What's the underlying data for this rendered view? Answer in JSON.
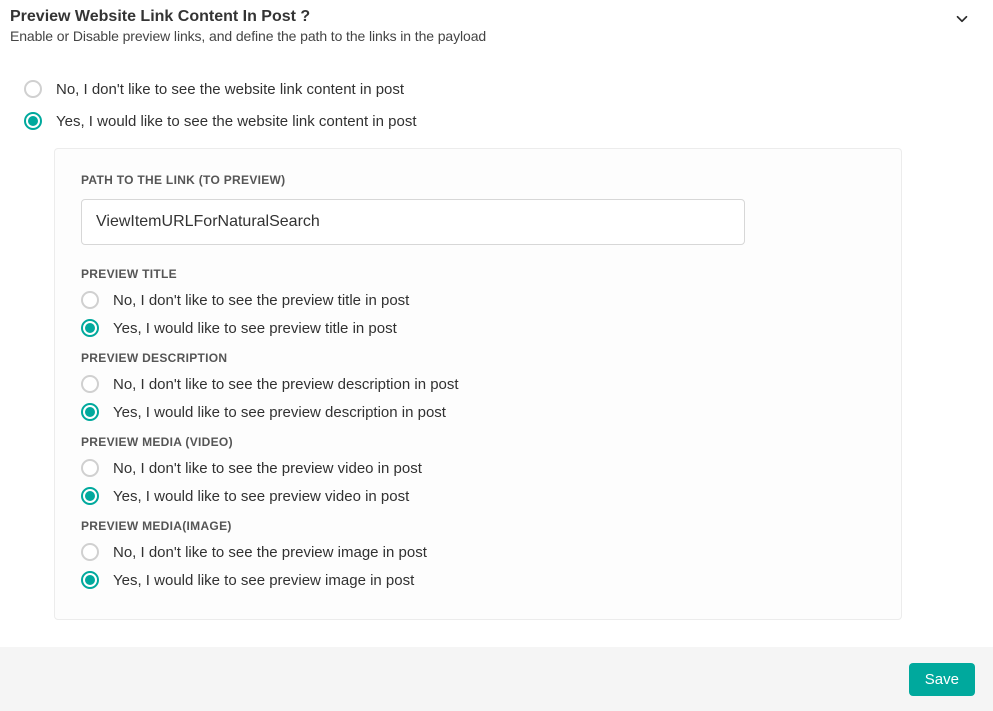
{
  "section": {
    "title": "Preview Website Link Content In Post ?",
    "subtitle": "Enable or Disable preview links, and define the path to the links in the payload"
  },
  "main": {
    "no": "No, I don't like to see the website link content in post",
    "yes": "Yes, I would like to see the website link content in post",
    "selected": "yes"
  },
  "path": {
    "label": "PATH TO THE LINK (TO PREVIEW)",
    "value": "ViewItemURLForNaturalSearch"
  },
  "title_group": {
    "label": "PREVIEW TITLE",
    "no": "No, I don't like to see the preview title in post",
    "yes": "Yes, I would like to see preview title in post",
    "selected": "yes"
  },
  "desc_group": {
    "label": "PREVIEW DESCRIPTION",
    "no": "No, I don't like to see the preview description in post",
    "yes": "Yes, I would like to see preview description in post",
    "selected": "yes"
  },
  "video_group": {
    "label": "PREVIEW MEDIA (VIDEO)",
    "no": "No, I don't like to see the preview video in post",
    "yes": "Yes, I would like to see preview video in post",
    "selected": "yes"
  },
  "image_group": {
    "label": "PREVIEW MEDIA(IMAGE)",
    "no": "No, I don't like to see the preview image in post",
    "yes": "Yes, I would like to see preview image in post",
    "selected": "yes"
  },
  "footer": {
    "save": "Save"
  },
  "colors": {
    "accent": "#00a99d"
  }
}
